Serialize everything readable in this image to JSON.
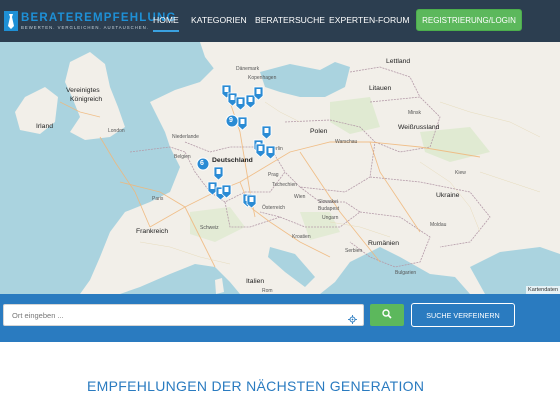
{
  "brand": {
    "name": "BERATEREMPFEHLUNG",
    "tagline": "BEWERTEN. VERGLEICHEN. AUSTAUSCHEN."
  },
  "nav": {
    "items": [
      {
        "label": "HOME",
        "active": true
      },
      {
        "label": "KATEGORIEN",
        "active": false
      },
      {
        "label": "BERATERSUCHE",
        "active": false
      },
      {
        "label": "EXPERTEN-FORUM",
        "active": false
      }
    ],
    "register_label": "REGISTRIERUNG/LOGIN"
  },
  "map": {
    "labels": {
      "vereinigtes": "Vereinigtes",
      "koenigreich": "Königreich",
      "irland": "Irland",
      "london": "London",
      "niederlande": "Niederlande",
      "deutschland": "Deutschland",
      "polen": "Polen",
      "frankreich": "Frankreich",
      "italien": "Italien",
      "ukraine": "Ukraine",
      "rumaenien": "Rumänien",
      "weissrussland": "Weißrussland",
      "litauen": "Litauen",
      "lettland": "Lettland",
      "tschechien": "Tschechien",
      "slowakei": "Slowakei",
      "ungarn": "Ungarn",
      "oesterreich": "Österreich",
      "schweiz": "Schweiz",
      "serbien": "Serbien",
      "kroatien": "Kroatien",
      "moldau": "Moldau",
      "bulgarien": "Bulgarien",
      "belgien": "Belgien",
      "danemark": "Dänemark",
      "warschau": "Warschau",
      "paris": "Paris",
      "kopenhagen": "Kopenhagen",
      "berlin": "Berlin",
      "kiew": "Kiew",
      "minsk": "Minsk",
      "budapest": "Budapest",
      "wien": "Wien",
      "prag": "Prag",
      "rom": "Rom",
      "attribution": "Kartendaten"
    },
    "clusters": [
      {
        "count": "9"
      },
      {
        "count": "6"
      }
    ]
  },
  "search": {
    "placeholder": "Ort eingeben ...",
    "refine_label": "SUCHE VERFEINERN"
  },
  "main": {
    "heading": "EMPFEHLUNGEN DER NÄCHSTEN GENERATION"
  },
  "colors": {
    "header_bg": "#2c3e50",
    "accent_blue": "#2a7bc0",
    "brand_blue": "#1e90d6",
    "green": "#5cb85c",
    "water": "#aad3df",
    "land": "#f2efe9"
  }
}
